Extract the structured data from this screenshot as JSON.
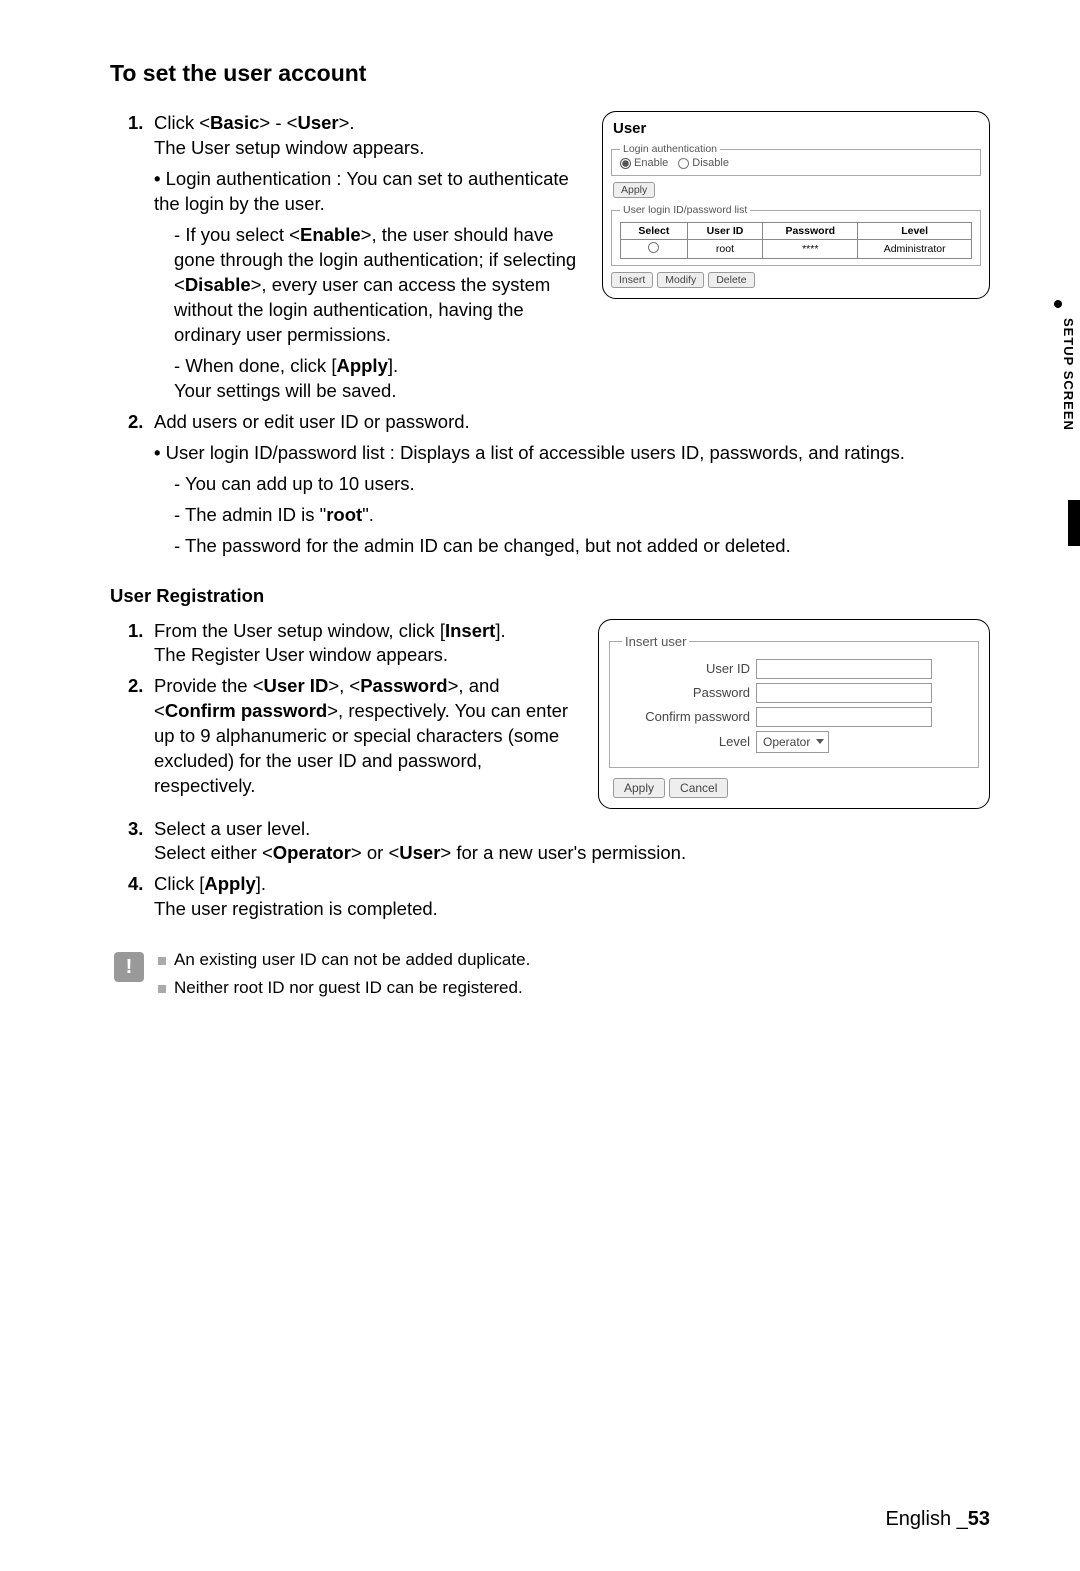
{
  "sideTab": "SETUP SCREEN",
  "title": "To set the user account",
  "sec1": {
    "num": "1.",
    "t1a": "Click <",
    "t1b": "Basic",
    "t1c": "> - <",
    "t1d": "User",
    "t1e": ">.",
    "t2": "The User setup window appears.",
    "b1": "Login authentication : You can set to authenticate the login by the user.",
    "d1a": "If you select <",
    "d1b": "Enable",
    "d1c": ">, the user should have gone through the login authentication; if selecting <",
    "d1d": "Disable",
    "d1e": ">, every user can access the system without the login authentication, having the ordinary user permissions.",
    "d2a": "When done, click [",
    "d2b": "Apply",
    "d2c": "].",
    "d2f": "Your settings will be saved."
  },
  "sec2": {
    "num": "2.",
    "t1": "Add users or edit user ID or password.",
    "b1": "User login ID/password list : Displays a list of accessible users ID, passwords, and ratings.",
    "d1": "You can add up to 10 users.",
    "d2a": "The admin ID is \"",
    "d2b": "root",
    "d2c": "\".",
    "d3": "The password for the admin ID can be changed, but not added or deleted."
  },
  "userReg": {
    "heading": "User Registration",
    "s1": {
      "num": "1.",
      "t1a": "From the User setup window, click [",
      "t1b": "Insert",
      "t1c": "].",
      "t2": "The Register User window appears."
    },
    "s2": {
      "num": "2.",
      "t1a": "Provide the <",
      "t1b": "User ID",
      "t1c": ">, <",
      "t1d": "Password",
      "t1e": ">, and <",
      "t1f": "Confirm password",
      "t1g": ">, respectively. You can enter up to 9 alphanumeric or special characters (some excluded) for the user ID and password, respectively."
    },
    "s3": {
      "num": "3.",
      "t1": "Select a user level.",
      "t2a": "Select either <",
      "t2b": "Operator",
      "t2c": "> or <",
      "t2d": "User",
      "t2e": "> for a new user's permission."
    },
    "s4": {
      "num": "4.",
      "t1a": "Click [",
      "t1b": "Apply",
      "t1c": "].",
      "t2": "The user registration is completed."
    }
  },
  "notes": {
    "n1": "An existing user ID can not be added duplicate.",
    "n2": "Neither root ID nor guest ID can be registered."
  },
  "fig1": {
    "title": "User",
    "legend1": "Login authentication",
    "enable": "Enable",
    "disable": "Disable",
    "apply": "Apply",
    "legend2": "User login ID/password list",
    "th": {
      "select": "Select",
      "userId": "User ID",
      "password": "Password",
      "level": "Level"
    },
    "row": {
      "userId": "root",
      "password": "****",
      "level": "Administrator"
    },
    "insert": "Insert",
    "modify": "Modify",
    "delete": "Delete"
  },
  "fig2": {
    "legend": "Insert user",
    "userId": "User ID",
    "password": "Password",
    "confirm": "Confirm password",
    "level": "Level",
    "levelValue": "Operator",
    "apply": "Apply",
    "cancel": "Cancel"
  },
  "footer": {
    "lang": "English _",
    "page": "53"
  }
}
